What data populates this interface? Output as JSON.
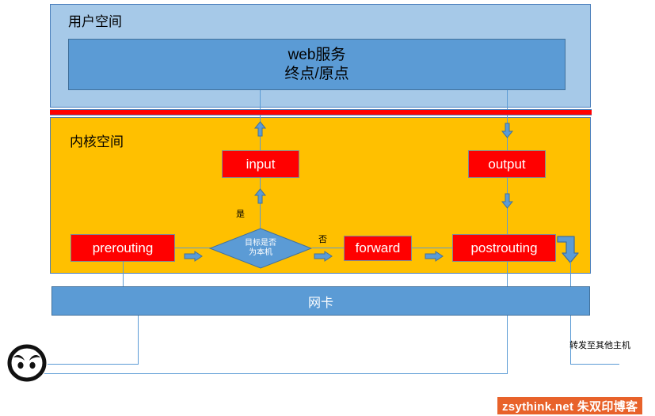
{
  "diagram": {
    "title": "netfilter packet flow",
    "zones": {
      "userspace_label": "用户空间",
      "kernelspace_label": "内核空间"
    },
    "boxes": {
      "web_service_line1": "web服务",
      "web_service_line2": "终点/原点",
      "input": "input",
      "output": "output",
      "prerouting": "prerouting",
      "forward": "forward",
      "postrouting": "postrouting",
      "nic": "网卡"
    },
    "decision": {
      "line1": "目标是否",
      "line2": "为本机"
    },
    "labels": {
      "yes": "是",
      "no": "否",
      "forward_to_other_hosts": "转发至其他主机"
    },
    "icons": {
      "face": "angry-face-icon"
    },
    "colors": {
      "userspace_fill": "#A6C9E8",
      "kernelspace_fill": "#FFC000",
      "separator": "#FF0000",
      "box_blue": "#5B9BD5",
      "box_red": "#FF0000",
      "line_blue": "#5B9BD5",
      "watermark_bg": "#E8622A"
    }
  },
  "watermark": {
    "text": "zsythink.net 朱双印博客"
  }
}
